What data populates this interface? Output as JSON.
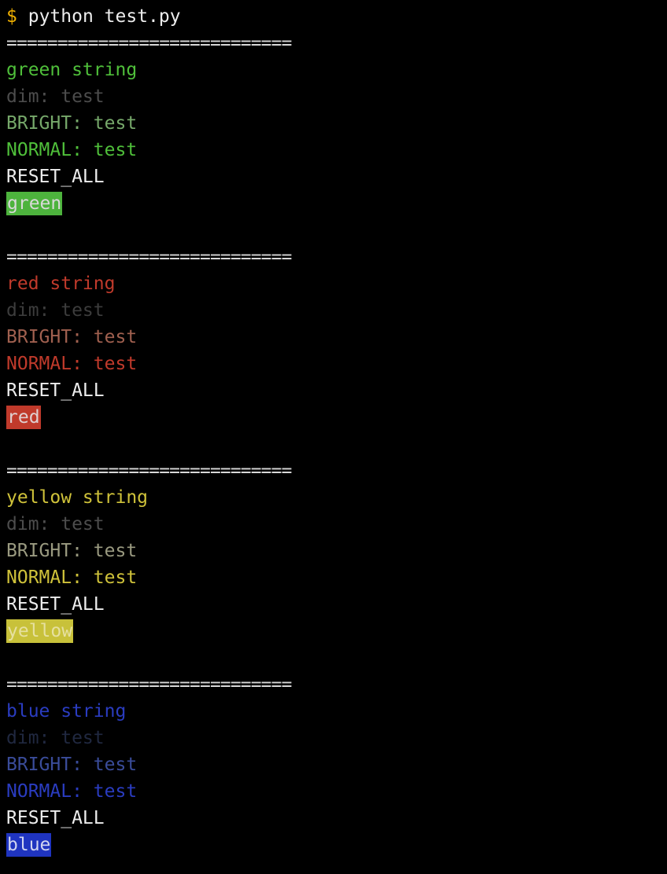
{
  "prompt": {
    "sign": "$",
    "command": "python test.py"
  },
  "blocks": [
    {
      "separator": "============================",
      "title": "green string",
      "dim_label": "dim: test",
      "bright_label": "BRIGHT: test",
      "normal_label": "NORMAL: test",
      "reset_label": "RESET_ALL",
      "bg_label": "green",
      "colors": {
        "title": "#4fbf3a",
        "dim": "#4c4c4c",
        "bright": "#76a86a",
        "normal": "#4fbf3a",
        "reset": "#ededed",
        "bg": "#4db33d",
        "bg_text": "#d9d9d9"
      }
    },
    {
      "separator": "============================",
      "title": "red string",
      "dim_label": "dim: test",
      "bright_label": "BRIGHT: test",
      "normal_label": "NORMAL: test",
      "reset_label": "RESET_ALL",
      "bg_label": "red",
      "colors": {
        "title": "#c03a2b",
        "dim": "#3c3c3c",
        "bright": "#a0604f",
        "normal": "#c03a2b",
        "reset": "#ededed",
        "bg": "#c03a2b",
        "bg_text": "#e0d0d0"
      }
    },
    {
      "separator": "============================",
      "title": "yellow string",
      "dim_label": "dim: test",
      "bright_label": "BRIGHT: test",
      "normal_label": "NORMAL: test",
      "reset_label": "RESET_ALL",
      "bg_label": "yellow",
      "colors": {
        "title": "#cfc23a",
        "dim": "#4c4c4c",
        "bright": "#9a9a80",
        "normal": "#cfc23a",
        "reset": "#ededed",
        "bg": "#c8c13a",
        "bg_text": "#e6e0a0"
      }
    },
    {
      "separator": "============================",
      "title": "blue string",
      "dim_label": "dim: test",
      "bright_label": "BRIGHT: test",
      "normal_label": "NORMAL: test",
      "reset_label": "RESET_ALL",
      "bg_label": "blue",
      "colors": {
        "title": "#2a3cc0",
        "dim": "#202840",
        "bright": "#3a4c9a",
        "normal": "#2a3cc0",
        "reset": "#ededed",
        "bg": "#1f34c0",
        "bg_text": "#d0d4f0"
      }
    }
  ]
}
